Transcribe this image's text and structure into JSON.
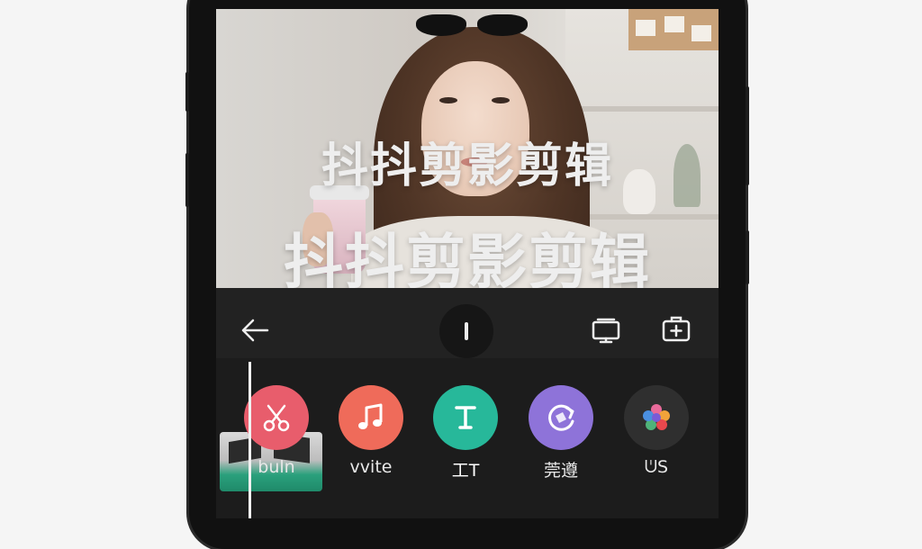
{
  "preview": {
    "caption_line1": "抖抖剪影剪辑",
    "caption_line2": "抖抖剪影剪辑"
  },
  "toolbar": {
    "back_icon": "arrow-left-icon",
    "playhead_icon": "playhead-icon",
    "screen_icon": "display-icon",
    "add_icon": "add-box-icon"
  },
  "tools": [
    {
      "label": "buln",
      "icon": "scissors-icon",
      "color": "#e85d6c"
    },
    {
      "label": "vvite",
      "icon": "music-note-icon",
      "color": "#ef6b5a"
    },
    {
      "label": "工T",
      "icon": "text-icon",
      "color": "#27b89a"
    },
    {
      "label": "莞遵",
      "icon": "rotate-icon",
      "color": "#8e73d9"
    },
    {
      "label": "ᕫS",
      "icon": "flower-icon",
      "color": "#2f2f2f"
    }
  ],
  "colors": {
    "background": "#1a1a1a",
    "toolbar": "#222222"
  }
}
